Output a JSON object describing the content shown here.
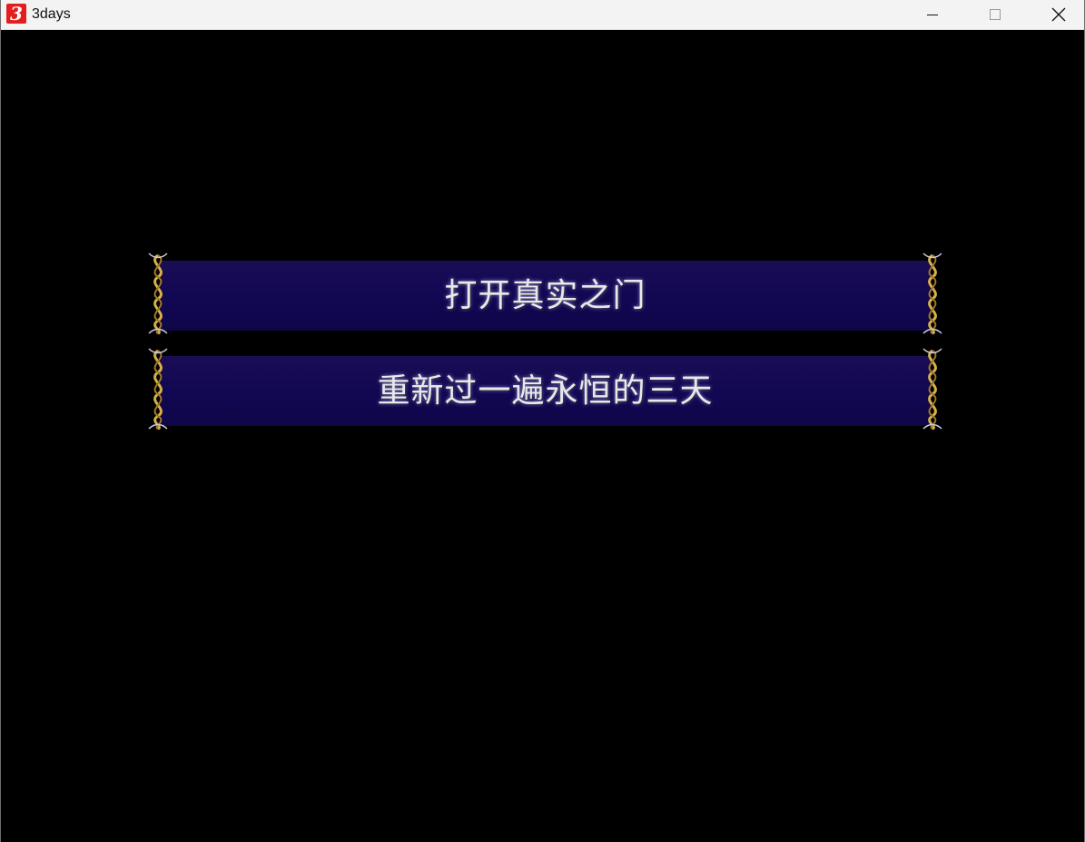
{
  "window": {
    "title": "3days",
    "icon_glyph": "3",
    "icon_color": "#e41e1e",
    "controls": [
      "minimize-icon",
      "maximize-icon",
      "close-icon"
    ]
  },
  "menu": {
    "options": [
      {
        "label": "打开真实之门"
      },
      {
        "label": "重新过一遍永恒的三天"
      }
    ],
    "band_color": "#120752",
    "ornament_color": "#d8b04a"
  }
}
